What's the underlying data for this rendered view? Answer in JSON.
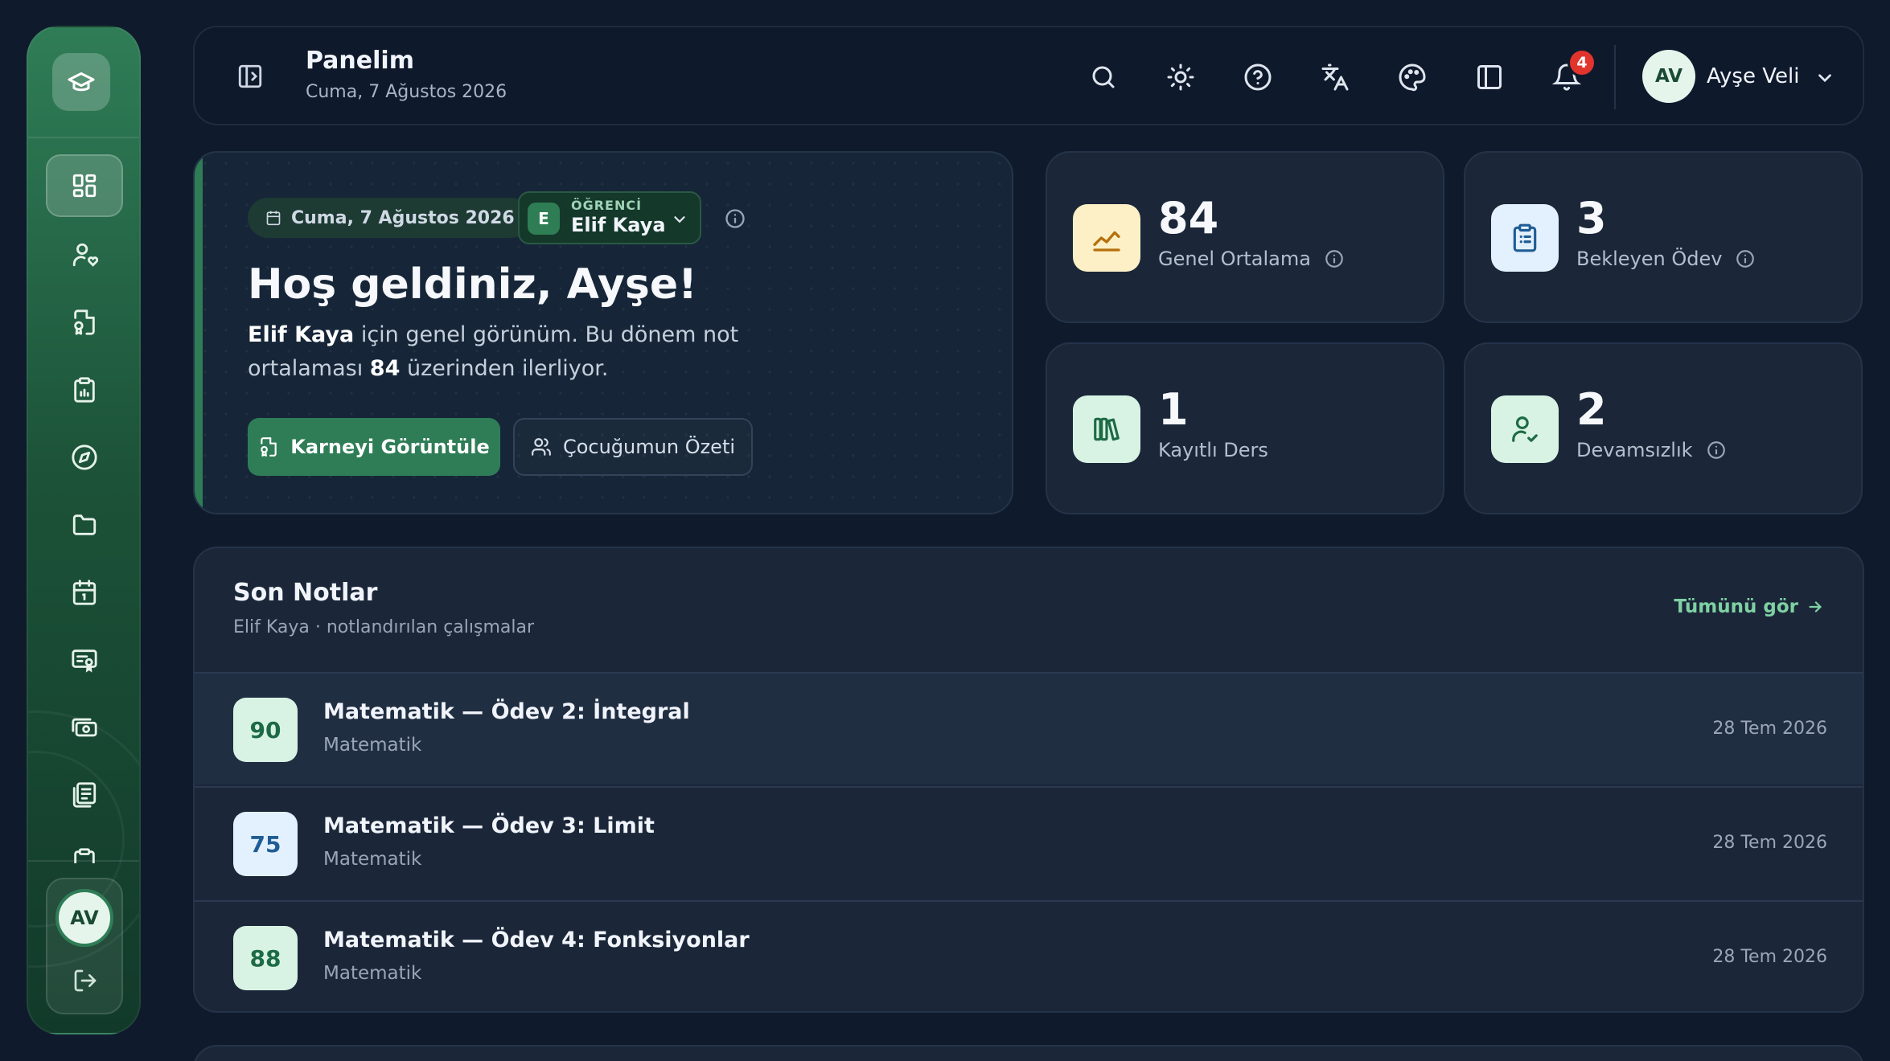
{
  "colors": {
    "accent": "#2f7d57",
    "background": "#101a2d",
    "card": "#1b2739",
    "badge": "#e1342c",
    "link": "#7fd1a3"
  },
  "sidebar": {
    "logo_icon": "graduation-cap-icon",
    "items": [
      {
        "icon": "dashboard-icon",
        "active": true
      },
      {
        "icon": "user-heart-icon",
        "active": false
      },
      {
        "icon": "report-card-icon",
        "active": false
      },
      {
        "icon": "clipboard-icon",
        "active": false
      },
      {
        "icon": "compass-icon",
        "active": false
      },
      {
        "icon": "folder-icon",
        "active": false
      },
      {
        "icon": "calendar-icon",
        "active": false
      },
      {
        "icon": "certificate-icon",
        "active": false
      },
      {
        "icon": "payment-icon",
        "active": false
      },
      {
        "icon": "documents-icon",
        "active": false
      },
      {
        "icon": "clipboard-icon",
        "active": false
      }
    ],
    "user_initials": "AV",
    "logout_icon": "logout-icon"
  },
  "header": {
    "title": "Panelim",
    "date": "Cuma, 7 Ağustos 2026",
    "notification_count": "4",
    "user_initials": "AV",
    "user_name": "Ayşe Veli"
  },
  "welcome": {
    "date_pill": "Cuma, 7 Ağustos 2026",
    "student_label": "ÖĞRENCİ",
    "student_initial": "E",
    "student_name": "Elif Kaya",
    "heading": "Hoş geldiniz, Ayşe!",
    "desc_name": "Elif Kaya",
    "desc_middle": " için genel görünüm. Bu dönem not ortalaması ",
    "desc_avg": "84",
    "desc_end": " üzerinden ilerliyor.",
    "primary_button": "Karneyi Görüntüle",
    "secondary_button": "Çocuğumun Özeti"
  },
  "stats": [
    {
      "value": "84",
      "label": "Genel Ortalama",
      "icon": "chart-line-icon",
      "info": true
    },
    {
      "value": "3",
      "label": "Bekleyen Ödev",
      "icon": "clipboard-list-icon",
      "info": true
    },
    {
      "value": "1",
      "label": "Kayıtlı Ders",
      "icon": "books-icon",
      "info": false
    },
    {
      "value": "2",
      "label": "Devamsızlık",
      "icon": "user-check-icon",
      "info": true
    }
  ],
  "grades": {
    "title": "Son Notlar",
    "subtitle": "Elif Kaya · notlandırılan çalışmalar",
    "see_all": "Tümünü gör",
    "rows": [
      {
        "score": "90",
        "name": "Matematik — Ödev 2: İntegral",
        "subject": "Matematik",
        "date": "28 Tem 2026"
      },
      {
        "score": "75",
        "name": "Matematik — Ödev 3: Limit",
        "subject": "Matematik",
        "date": "28 Tem 2026"
      },
      {
        "score": "88",
        "name": "Matematik — Ödev 4: Fonksiyonlar",
        "subject": "Matematik",
        "date": "28 Tem 2026"
      }
    ]
  }
}
